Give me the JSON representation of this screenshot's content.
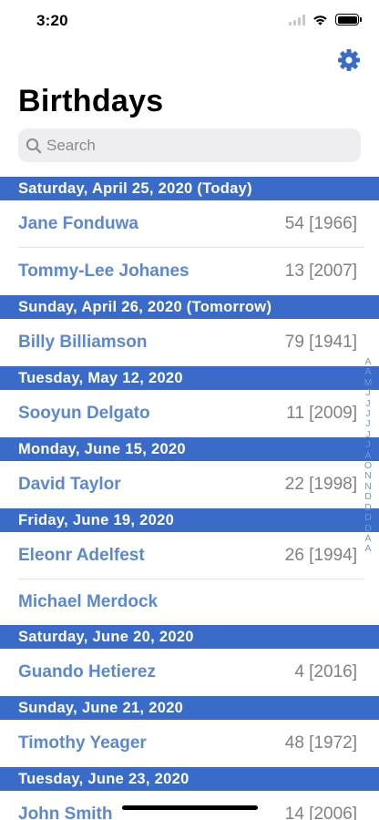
{
  "status_bar": {
    "time": "3:20"
  },
  "header": {
    "title": "Birthdays",
    "settings_icon": "gear-icon"
  },
  "search": {
    "placeholder": "Search",
    "value": ""
  },
  "colors": {
    "accent": "#3a6bc8",
    "name_text": "#5b88d4",
    "age_text": "#808085"
  },
  "sections": [
    {
      "title": "Saturday, April 25, 2020  (Today)",
      "rows": [
        {
          "name": "Jane Fonduwa",
          "age": "54 [1966]"
        },
        {
          "name": "Tommy-Lee Johanes",
          "age": "13 [2007]"
        }
      ]
    },
    {
      "title": "Sunday, April 26, 2020  (Tomorrow)",
      "rows": [
        {
          "name": "Billy Billiamson",
          "age": "79 [1941]"
        }
      ]
    },
    {
      "title": "Tuesday, May 12, 2020",
      "rows": [
        {
          "name": "Sooyun Delgato",
          "age": "11 [2009]"
        }
      ]
    },
    {
      "title": "Monday, June 15, 2020",
      "rows": [
        {
          "name": "David Taylor",
          "age": "22 [1998]"
        }
      ]
    },
    {
      "title": "Friday, June 19, 2020",
      "rows": [
        {
          "name": "Eleonr Adelfest",
          "age": "26 [1994]"
        },
        {
          "name": "Michael Merdock",
          "age": ""
        }
      ]
    },
    {
      "title": "Saturday, June 20, 2020",
      "rows": [
        {
          "name": "Guando Hetierez",
          "age": "4 [2016]"
        }
      ]
    },
    {
      "title": "Sunday, June 21, 2020",
      "rows": [
        {
          "name": "Timothy Yeager",
          "age": "48 [1972]"
        }
      ]
    },
    {
      "title": "Tuesday, June 23, 2020",
      "rows": [
        {
          "name": "John Smith",
          "age": "14 [2006]"
        }
      ]
    }
  ],
  "index_letters": [
    "A",
    "A",
    "M",
    "J",
    "J",
    "J",
    "J",
    "J",
    "J",
    "A",
    "O",
    "N",
    "N",
    "D",
    "D",
    "D",
    "D",
    "A",
    "A"
  ]
}
